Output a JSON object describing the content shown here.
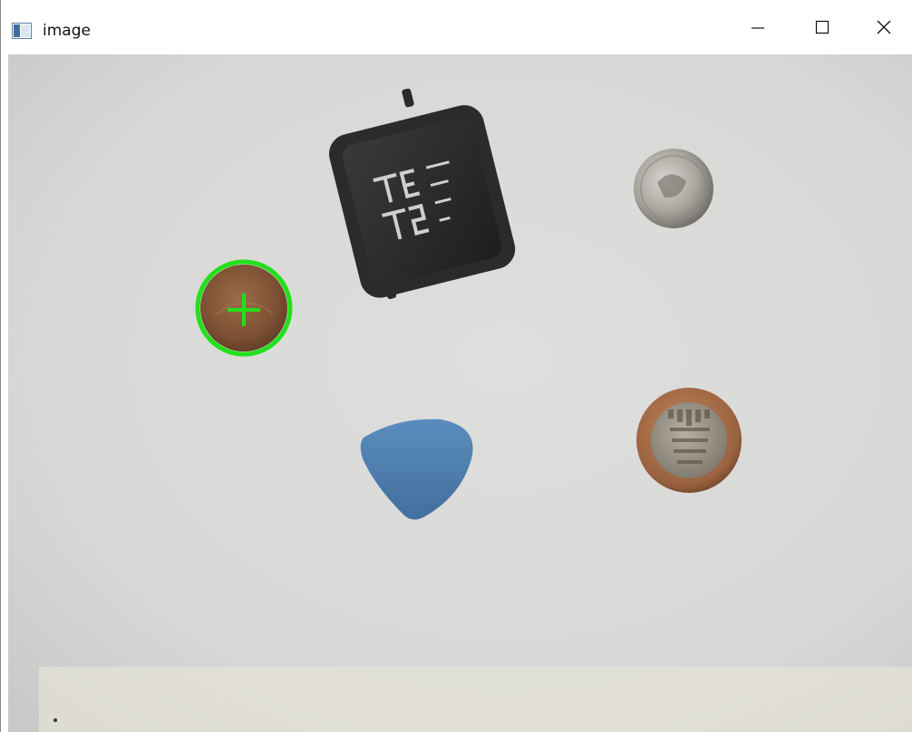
{
  "window": {
    "title": "image",
    "app_icon": "window-image-icon",
    "controls": {
      "minimize_icon": "minimize-icon",
      "maximize_icon": "maximize-icon",
      "close_icon": "close-icon"
    }
  },
  "image_view": {
    "background_color": "#d9d9d7",
    "highlight_color": "#22e01a",
    "objects": [
      {
        "name": "smartwatch",
        "color": "#2e2e2e"
      },
      {
        "name": "coin-silver",
        "color": "#b3b0a8"
      },
      {
        "name": "coin-copper",
        "color": "#8a5a3a"
      },
      {
        "name": "guitar-pick",
        "color": "#4e7fb0"
      },
      {
        "name": "coin-bimetal",
        "color": "#a06a44"
      }
    ]
  }
}
